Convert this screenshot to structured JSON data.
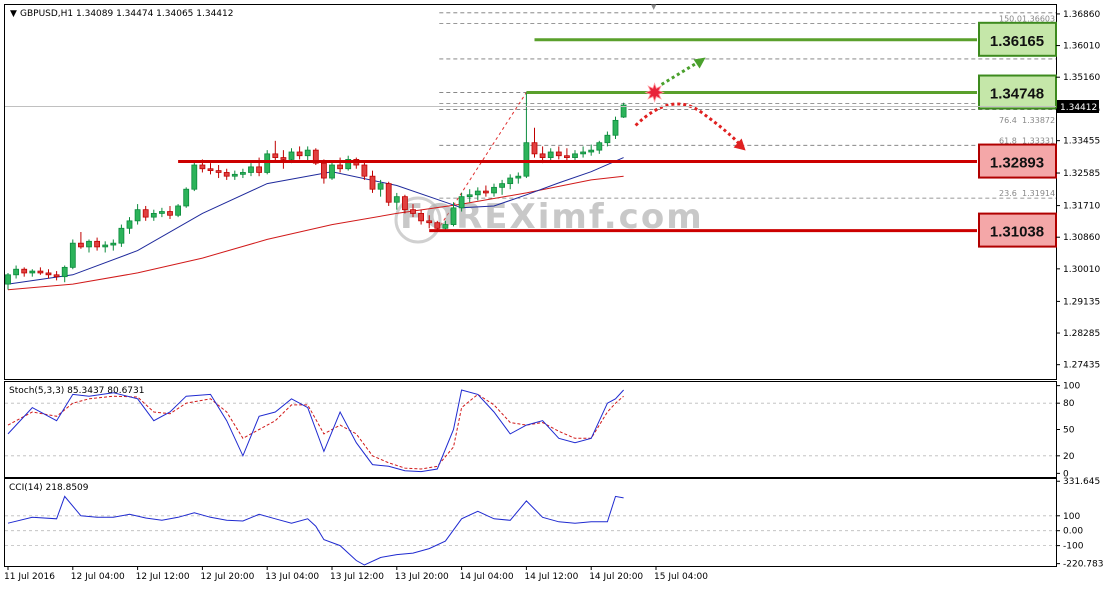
{
  "chart_data": {
    "type": "candlestick",
    "symbol_header": "GBPUSD,H1  1.34089 1.34474 1.34065 1.34412",
    "current_price": "1.34412",
    "price_axis": {
      "ylim": [
        1.2705,
        1.371
      ],
      "ticks": [
        "1.36860",
        "1.36010",
        "1.35160",
        "1.34305",
        "1.33455",
        "1.32585",
        "1.31710",
        "1.30860",
        "1.30010",
        "1.29135",
        "1.28285",
        "1.27435"
      ]
    },
    "time_axis": {
      "labels": [
        "11 Jul 2016",
        "12 Jul 04:00",
        "12 Jul 12:00",
        "12 Jul 20:00",
        "13 Jul 04:00",
        "13 Jul 12:00",
        "13 Jul 20:00",
        "14 Jul 04:00",
        "14 Jul 12:00",
        "14 Jul 20:00",
        "15 Jul 04:00"
      ],
      "label_every_bars": 8
    },
    "candles": [
      [
        1.296,
        1.299,
        1.2945,
        1.2985
      ],
      [
        1.2985,
        1.301,
        1.2975,
        1.3
      ],
      [
        1.3,
        1.3005,
        1.298,
        1.299
      ],
      [
        1.299,
        1.3,
        1.298,
        1.2995
      ],
      [
        1.2995,
        1.3005,
        1.2985,
        1.299
      ],
      [
        1.299,
        1.3,
        1.2975,
        1.2985
      ],
      [
        1.2985,
        1.2995,
        1.297,
        1.298
      ],
      [
        1.298,
        1.301,
        1.2965,
        1.3005
      ],
      [
        1.3005,
        1.308,
        1.3,
        1.307
      ],
      [
        1.307,
        1.31,
        1.3055,
        1.306
      ],
      [
        1.306,
        1.308,
        1.3045,
        1.3075
      ],
      [
        1.3075,
        1.3085,
        1.305,
        1.306
      ],
      [
        1.306,
        1.3075,
        1.3045,
        1.3065
      ],
      [
        1.3065,
        1.308,
        1.305,
        1.307
      ],
      [
        1.307,
        1.312,
        1.306,
        1.311
      ],
      [
        1.311,
        1.314,
        1.3095,
        1.313
      ],
      [
        1.313,
        1.3175,
        1.312,
        1.316
      ],
      [
        1.316,
        1.317,
        1.313,
        1.314
      ],
      [
        1.314,
        1.316,
        1.313,
        1.315
      ],
      [
        1.315,
        1.3165,
        1.314,
        1.3155
      ],
      [
        1.3155,
        1.317,
        1.3135,
        1.3145
      ],
      [
        1.3145,
        1.3175,
        1.314,
        1.317
      ],
      [
        1.317,
        1.322,
        1.3165,
        1.3215
      ],
      [
        1.3215,
        1.329,
        1.321,
        1.328
      ],
      [
        1.328,
        1.3295,
        1.326,
        1.327
      ],
      [
        1.327,
        1.3285,
        1.3255,
        1.3265
      ],
      [
        1.3265,
        1.328,
        1.3245,
        1.326
      ],
      [
        1.326,
        1.327,
        1.324,
        1.325
      ],
      [
        1.325,
        1.3265,
        1.324,
        1.3255
      ],
      [
        1.3255,
        1.327,
        1.3245,
        1.326
      ],
      [
        1.326,
        1.3285,
        1.325,
        1.3275
      ],
      [
        1.3275,
        1.33,
        1.325,
        1.326
      ],
      [
        1.326,
        1.332,
        1.3255,
        1.331
      ],
      [
        1.331,
        1.3345,
        1.329,
        1.33
      ],
      [
        1.33,
        1.332,
        1.327,
        1.3295
      ],
      [
        1.3295,
        1.3325,
        1.3285,
        1.3315
      ],
      [
        1.3315,
        1.333,
        1.3295,
        1.3305
      ],
      [
        1.3305,
        1.333,
        1.329,
        1.332
      ],
      [
        1.332,
        1.3325,
        1.328,
        1.3285
      ],
      [
        1.3285,
        1.3295,
        1.323,
        1.3245
      ],
      [
        1.3245,
        1.329,
        1.324,
        1.328
      ],
      [
        1.328,
        1.33,
        1.326,
        1.327
      ],
      [
        1.327,
        1.3305,
        1.3265,
        1.3295
      ],
      [
        1.3295,
        1.33,
        1.327,
        1.328
      ],
      [
        1.328,
        1.329,
        1.324,
        1.325
      ],
      [
        1.325,
        1.3265,
        1.3205,
        1.3215
      ],
      [
        1.3215,
        1.324,
        1.3195,
        1.323
      ],
      [
        1.323,
        1.3235,
        1.317,
        1.318
      ],
      [
        1.318,
        1.3205,
        1.316,
        1.3195
      ],
      [
        1.3195,
        1.32,
        1.315,
        1.316
      ],
      [
        1.316,
        1.3175,
        1.314,
        1.315
      ],
      [
        1.315,
        1.316,
        1.312,
        1.313
      ],
      [
        1.313,
        1.3145,
        1.311,
        1.3125
      ],
      [
        1.3125,
        1.313,
        1.31,
        1.311
      ],
      [
        1.311,
        1.313,
        1.3104,
        1.312
      ],
      [
        1.312,
        1.318,
        1.3115,
        1.3165
      ],
      [
        1.3165,
        1.3205,
        1.3155,
        1.3195
      ],
      [
        1.3195,
        1.3215,
        1.318,
        1.32
      ],
      [
        1.32,
        1.322,
        1.3185,
        1.321
      ],
      [
        1.321,
        1.3225,
        1.3195,
        1.3205
      ],
      [
        1.3205,
        1.323,
        1.3195,
        1.322
      ],
      [
        1.322,
        1.324,
        1.32,
        1.323
      ],
      [
        1.323,
        1.3255,
        1.3215,
        1.3245
      ],
      [
        1.3245,
        1.326,
        1.323,
        1.325
      ],
      [
        1.325,
        1.3475,
        1.3245,
        1.334
      ],
      [
        1.334,
        1.338,
        1.33,
        1.331
      ],
      [
        1.331,
        1.333,
        1.3285,
        1.33
      ],
      [
        1.33,
        1.3325,
        1.329,
        1.3315
      ],
      [
        1.3315,
        1.333,
        1.3295,
        1.3305
      ],
      [
        1.3305,
        1.3325,
        1.329,
        1.33
      ],
      [
        1.33,
        1.332,
        1.329,
        1.331
      ],
      [
        1.331,
        1.333,
        1.33,
        1.3315
      ],
      [
        1.3315,
        1.3335,
        1.3305,
        1.332
      ],
      [
        1.332,
        1.3345,
        1.331,
        1.334
      ],
      [
        1.334,
        1.337,
        1.333,
        1.336
      ],
      [
        1.336,
        1.341,
        1.335,
        1.34
      ],
      [
        1.34089,
        1.34474,
        1.34065,
        1.34412
      ]
    ],
    "ma_fast": [
      [
        0,
        1.296
      ],
      [
        8,
        1.2985
      ],
      [
        16,
        1.305
      ],
      [
        24,
        1.315
      ],
      [
        32,
        1.323
      ],
      [
        40,
        1.3262
      ],
      [
        48,
        1.3225
      ],
      [
        56,
        1.3165
      ],
      [
        60,
        1.317
      ],
      [
        64,
        1.32
      ],
      [
        68,
        1.3232
      ],
      [
        72,
        1.3262
      ],
      [
        76,
        1.33
      ]
    ],
    "ma_slow": [
      [
        0,
        1.2945
      ],
      [
        8,
        1.296
      ],
      [
        16,
        1.299
      ],
      [
        24,
        1.303
      ],
      [
        32,
        1.308
      ],
      [
        40,
        1.312
      ],
      [
        48,
        1.315
      ],
      [
        56,
        1.3175
      ],
      [
        64,
        1.3205
      ],
      [
        72,
        1.324
      ],
      [
        76,
        1.325
      ]
    ],
    "levels": [
      {
        "label": "1.36165",
        "price": 1.36165,
        "kind": "resistance",
        "color": "#5aa02c"
      },
      {
        "label": "1.34748",
        "price": 1.34748,
        "kind": "resistance",
        "color": "#5aa02c"
      },
      {
        "label": "1.32893",
        "price": 1.32893,
        "kind": "support",
        "color": "#cc0000"
      },
      {
        "label": "1.31038",
        "price": 1.31038,
        "kind": "support",
        "color": "#cc0000"
      }
    ],
    "fibonacci": {
      "from": {
        "bar": 53,
        "price": 1.3104
      },
      "to": {
        "bar": 64,
        "price": 1.3475
      },
      "labels": [
        {
          "label": "150.0",
          "value": "1.36603",
          "price": 1.36603
        },
        {
          "label": "76.4",
          "value": "1.33872",
          "price": 1.33872
        },
        {
          "label": "61.8",
          "value": "1.33331",
          "price": 1.33331
        },
        {
          "label": "23.6",
          "value": "1.31914",
          "price": 1.31914
        }
      ],
      "extra_lines": [
        1.3747,
        1.3689,
        1.366,
        1.3565,
        1.3475,
        1.3445,
        1.3429,
        1.3333,
        1.329,
        1.3191,
        1.3104
      ]
    },
    "stochastic": {
      "header": "Stoch(5,3,3) 85.3437 80.6731",
      "ylim": [
        -3,
        103
      ],
      "ticks": [
        "100",
        "80",
        "50",
        "20",
        "0"
      ],
      "tick_values": [
        100,
        80,
        50,
        20,
        0
      ],
      "main": [
        [
          0,
          45
        ],
        [
          3,
          75
        ],
        [
          6,
          60
        ],
        [
          8,
          90
        ],
        [
          10,
          88
        ],
        [
          13,
          92
        ],
        [
          16,
          85
        ],
        [
          18,
          60
        ],
        [
          20,
          70
        ],
        [
          22,
          88
        ],
        [
          25,
          90
        ],
        [
          27,
          60
        ],
        [
          29,
          20
        ],
        [
          31,
          65
        ],
        [
          33,
          70
        ],
        [
          35,
          85
        ],
        [
          37,
          75
        ],
        [
          39,
          25
        ],
        [
          41,
          70
        ],
        [
          43,
          35
        ],
        [
          45,
          10
        ],
        [
          47,
          8
        ],
        [
          49,
          3
        ],
        [
          51,
          2
        ],
        [
          53,
          5
        ],
        [
          55,
          50
        ],
        [
          56,
          95
        ],
        [
          58,
          90
        ],
        [
          60,
          70
        ],
        [
          62,
          45
        ],
        [
          64,
          55
        ],
        [
          66,
          60
        ],
        [
          68,
          40
        ],
        [
          70,
          35
        ],
        [
          72,
          40
        ],
        [
          74,
          80
        ],
        [
          75,
          85
        ],
        [
          76,
          95
        ]
      ],
      "signal": [
        [
          0,
          55
        ],
        [
          3,
          70
        ],
        [
          6,
          65
        ],
        [
          8,
          80
        ],
        [
          10,
          85
        ],
        [
          13,
          88
        ],
        [
          16,
          87
        ],
        [
          18,
          70
        ],
        [
          20,
          68
        ],
        [
          22,
          80
        ],
        [
          25,
          85
        ],
        [
          27,
          70
        ],
        [
          29,
          40
        ],
        [
          31,
          50
        ],
        [
          33,
          60
        ],
        [
          35,
          78
        ],
        [
          37,
          78
        ],
        [
          39,
          45
        ],
        [
          41,
          55
        ],
        [
          43,
          45
        ],
        [
          45,
          20
        ],
        [
          47,
          12
        ],
        [
          49,
          6
        ],
        [
          51,
          5
        ],
        [
          53,
          8
        ],
        [
          55,
          30
        ],
        [
          56,
          75
        ],
        [
          58,
          90
        ],
        [
          60,
          78
        ],
        [
          62,
          58
        ],
        [
          64,
          55
        ],
        [
          66,
          58
        ],
        [
          68,
          48
        ],
        [
          70,
          40
        ],
        [
          72,
          40
        ],
        [
          74,
          70
        ],
        [
          75,
          80
        ],
        [
          76,
          88
        ]
      ]
    },
    "cci": {
      "header": "CCI(14) 218.8509",
      "ylim": [
        -230,
        340
      ],
      "ticks": [
        "331.645",
        "100",
        "0.00",
        "-100",
        "-220.783"
      ],
      "tick_values": [
        331.645,
        100,
        0,
        -100,
        -220.783
      ],
      "line": [
        [
          0,
          50
        ],
        [
          3,
          90
        ],
        [
          6,
          80
        ],
        [
          7,
          230
        ],
        [
          9,
          100
        ],
        [
          11,
          90
        ],
        [
          13,
          90
        ],
        [
          15,
          110
        ],
        [
          17,
          85
        ],
        [
          19,
          70
        ],
        [
          21,
          90
        ],
        [
          23,
          120
        ],
        [
          25,
          90
        ],
        [
          27,
          70
        ],
        [
          29,
          65
        ],
        [
          31,
          110
        ],
        [
          33,
          80
        ],
        [
          35,
          50
        ],
        [
          37,
          80
        ],
        [
          38,
          30
        ],
        [
          39,
          -60
        ],
        [
          41,
          -100
        ],
        [
          43,
          -200
        ],
        [
          44,
          -230
        ],
        [
          46,
          -180
        ],
        [
          48,
          -160
        ],
        [
          50,
          -150
        ],
        [
          52,
          -120
        ],
        [
          54,
          -70
        ],
        [
          56,
          80
        ],
        [
          58,
          130
        ],
        [
          60,
          80
        ],
        [
          62,
          70
        ],
        [
          64,
          200
        ],
        [
          66,
          90
        ],
        [
          68,
          60
        ],
        [
          70,
          50
        ],
        [
          72,
          60
        ],
        [
          74,
          60
        ],
        [
          75,
          230
        ],
        [
          76,
          220
        ]
      ]
    }
  },
  "watermark": "FOREXimf.com",
  "colors": {
    "bull": "#0b8a3c",
    "bear": "#c00000",
    "ma_fast": "#1f2a9c",
    "ma_slow": "#d11a1a",
    "stoch_main": "#1f2ad0",
    "stoch_signal": "#d11a1a",
    "cci": "#1f2ad0",
    "green_arrow": "#4aa02c",
    "red_arrow": "#e02020"
  }
}
